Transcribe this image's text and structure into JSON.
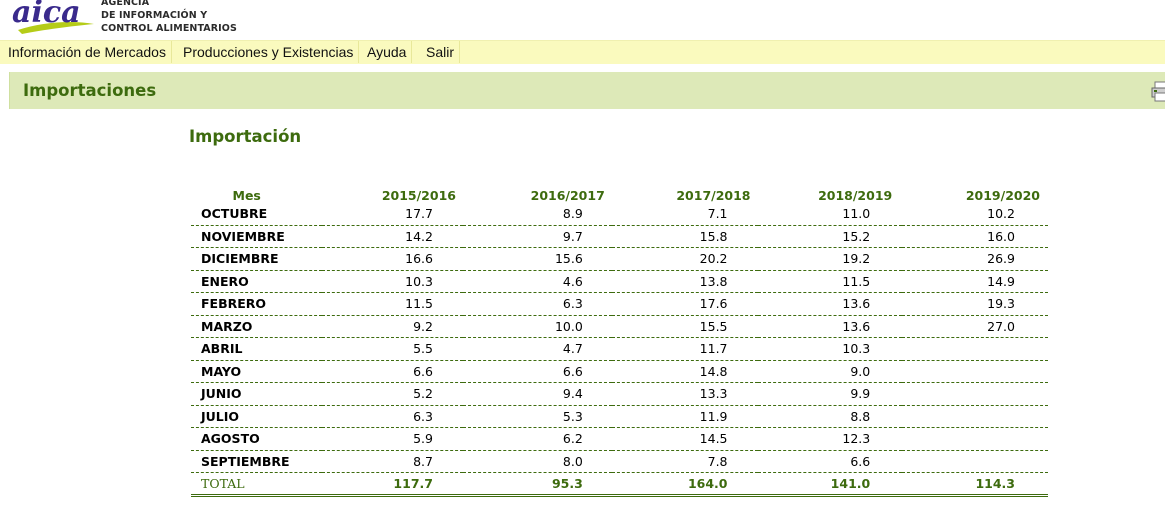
{
  "brand": {
    "logo_text": "aica",
    "line1": "AGENCIA",
    "line2": "DE INFORMACIÓN Y",
    "line3": "CONTROL ALIMENTARIOS",
    "logo_color": "#3a2a8c",
    "logo_swoosh_color": "#b5cc18"
  },
  "menu": {
    "items": [
      "Información de Mercados",
      "Producciones y Existencias",
      "Ayuda",
      "Salir"
    ]
  },
  "section": {
    "title": "Importaciones"
  },
  "subheading": "Importación",
  "table": {
    "headers": [
      "Mes",
      "2015/2016",
      "2016/2017",
      "2017/2018",
      "2018/2019",
      "2019/2020"
    ],
    "rows": [
      {
        "mes": "OCTUBRE",
        "v": [
          "17.7",
          "8.9",
          "7.1",
          "11.0",
          "10.2"
        ]
      },
      {
        "mes": "NOVIEMBRE",
        "v": [
          "14.2",
          "9.7",
          "15.8",
          "15.2",
          "16.0"
        ]
      },
      {
        "mes": "DICIEMBRE",
        "v": [
          "16.6",
          "15.6",
          "20.2",
          "19.2",
          "26.9"
        ]
      },
      {
        "mes": "ENERO",
        "v": [
          "10.3",
          "4.6",
          "13.8",
          "11.5",
          "14.9"
        ]
      },
      {
        "mes": "FEBRERO",
        "v": [
          "11.5",
          "6.3",
          "17.6",
          "13.6",
          "19.3"
        ]
      },
      {
        "mes": "MARZO",
        "v": [
          "9.2",
          "10.0",
          "15.5",
          "13.6",
          "27.0"
        ]
      },
      {
        "mes": "ABRIL",
        "v": [
          "5.5",
          "4.7",
          "11.7",
          "10.3",
          ""
        ]
      },
      {
        "mes": "MAYO",
        "v": [
          "6.6",
          "6.6",
          "14.8",
          "9.0",
          ""
        ]
      },
      {
        "mes": "JUNIO",
        "v": [
          "5.2",
          "9.4",
          "13.3",
          "9.9",
          ""
        ]
      },
      {
        "mes": "JULIO",
        "v": [
          "6.3",
          "5.3",
          "11.9",
          "8.8",
          ""
        ]
      },
      {
        "mes": "AGOSTO",
        "v": [
          "5.9",
          "6.2",
          "14.5",
          "12.3",
          ""
        ]
      },
      {
        "mes": "SEPTIEMBRE",
        "v": [
          "8.7",
          "8.0",
          "7.8",
          "6.6",
          ""
        ]
      }
    ],
    "total": {
      "mes": "TOTAL",
      "v": [
        "117.7",
        "95.3",
        "164.0",
        "141.0",
        "114.3"
      ]
    }
  },
  "colors": {
    "accent_green": "#3d6b0e",
    "menubar_bg": "#fafabe",
    "section_bg": "#dde9b8"
  },
  "icons": {
    "print": "printer-icon"
  }
}
